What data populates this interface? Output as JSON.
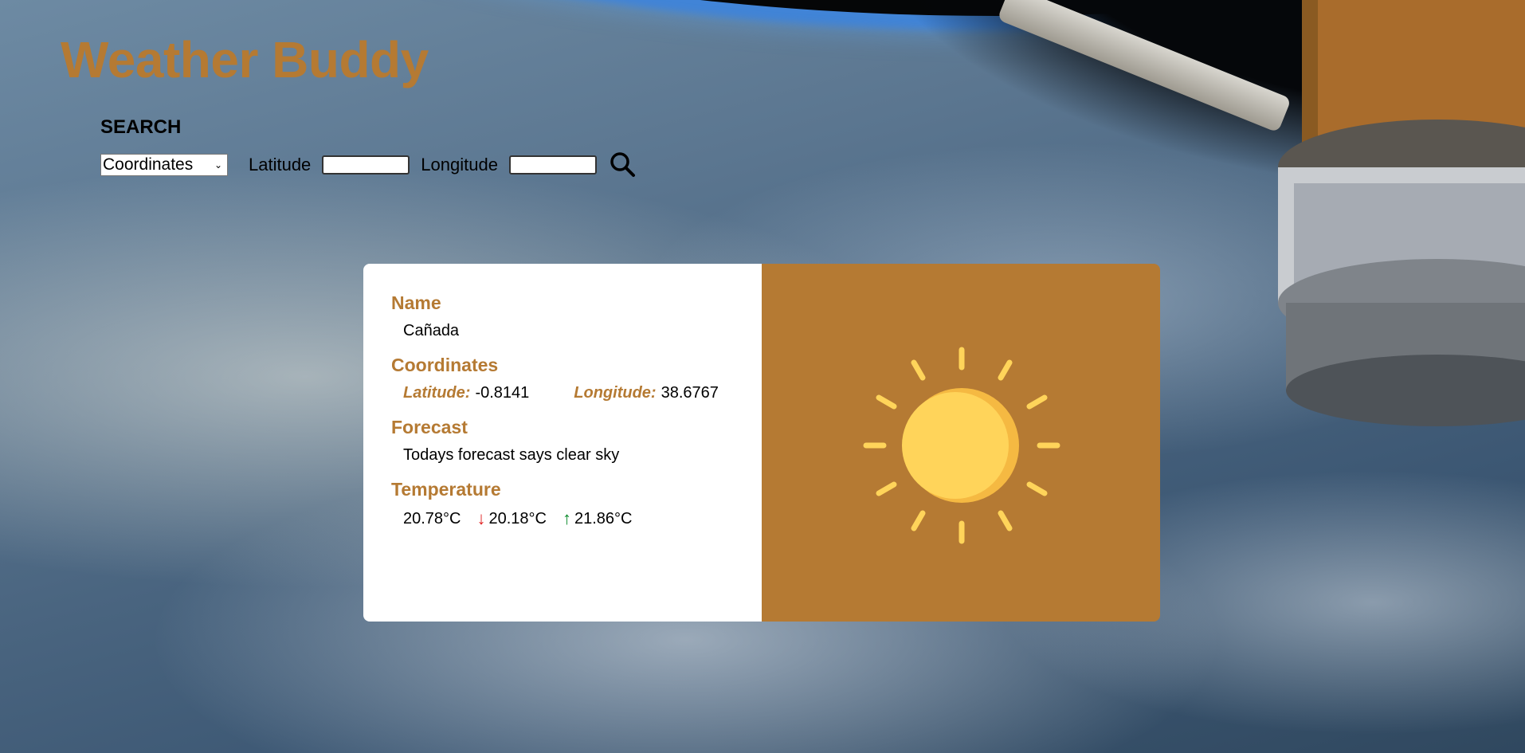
{
  "app": {
    "title": "Weather Buddy"
  },
  "search": {
    "heading": "SEARCH",
    "type_selected": "Coordinates",
    "latitude_label": "Latitude",
    "latitude_value": "",
    "longitude_label": "Longitude",
    "longitude_value": "",
    "button_icon": "search-icon"
  },
  "result": {
    "name_title": "Name",
    "name_value": "Cañada",
    "coords_title": "Coordinates",
    "latitude_label": "Latitude:",
    "latitude_value": "-0.8141",
    "longitude_label": "Longitude:",
    "longitude_value": "38.6767",
    "forecast_title": "Forecast",
    "forecast_value": "Todays forecast says clear sky",
    "temperature_title": "Temperature",
    "temp_current": "20.78°C",
    "temp_min": "20.18°C",
    "temp_max": "21.86°C",
    "weather_icon": "sun-icon"
  },
  "colors": {
    "accent": "#b57a33",
    "sun": "#ffd45a",
    "sun_shade": "#f5b942",
    "down_arrow": "#e02020",
    "up_arrow": "#0a8a2a"
  }
}
